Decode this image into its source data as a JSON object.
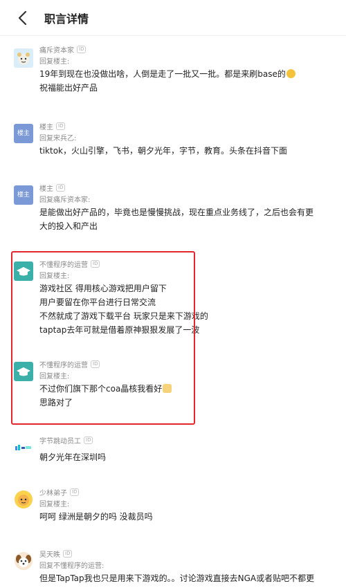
{
  "header": {
    "title": "职言详情"
  },
  "comments": [
    {
      "name": "痛斥资本家",
      "id_badge": "ID",
      "reply_to": "回复楼主:",
      "lines": [
        "19年到现在也没做出啥，人倒是走了一批又一批。都是来刷base的",
        "祝福能出好产品"
      ],
      "avatar": "bear-cartoon-icon"
    },
    {
      "name": "楼主",
      "id_badge": "ID",
      "reply_to": "回复宋兵乙:",
      "lines": [
        "tiktok，火山引擎，飞书，朝夕光年，字节，教育。头条在抖音下面"
      ],
      "avatar": "楼主"
    },
    {
      "name": "楼主",
      "id_badge": "ID",
      "reply_to": "回复痛斥资本家:",
      "lines": [
        "是能做出好产品的，毕竟也是慢慢挑战，现在重点业务线了，之后也会有更",
        "大的投入和产出"
      ],
      "avatar": "楼主"
    },
    {
      "name": "不懂程序的运营",
      "id_badge": "ID",
      "reply_to": "回复楼主:",
      "lines": [
        "游戏社区 得用核心游戏把用户留下",
        "用户要留在你平台进行日常交流",
        "不然就成了游戏下载平台 玩家只是来下游戏的",
        "taptap去年可就是借着原神狠狠发展了一波"
      ],
      "avatar": "graduation-cap-icon"
    },
    {
      "name": "不懂程序的运营",
      "id_badge": "ID",
      "reply_to": "回复楼主:",
      "lines": [
        "不过你们旗下那个coa晶核我看好",
        "思路对了"
      ],
      "avatar": "graduation-cap-icon"
    },
    {
      "name": "字节跳动员工",
      "id_badge": "ID",
      "reply_to": "",
      "lines": [
        "朝夕光年在深圳吗"
      ],
      "avatar": "bytedance-logo-icon"
    },
    {
      "name": "少林弟子",
      "id_badge": "ID",
      "reply_to": "回复楼主:",
      "lines": [
        "呵呵 绿洲是朝夕的吗 没裁员吗"
      ],
      "avatar": "monk-cartoon-icon"
    },
    {
      "name": "吴天昳",
      "id_badge": "ID",
      "reply_to": "回复不懂程序的运营:",
      "lines": [
        "但是TapTap我也只是用来下游戏的。。讨论游戏直接去NGA或者贴吧不都更"
      ],
      "avatar": "dog-cartoon-icon"
    }
  ],
  "colors": {
    "highlight": "#e4262c",
    "owner_avatar": "#7b99d6",
    "operator_avatar": "#3bb0a8"
  }
}
